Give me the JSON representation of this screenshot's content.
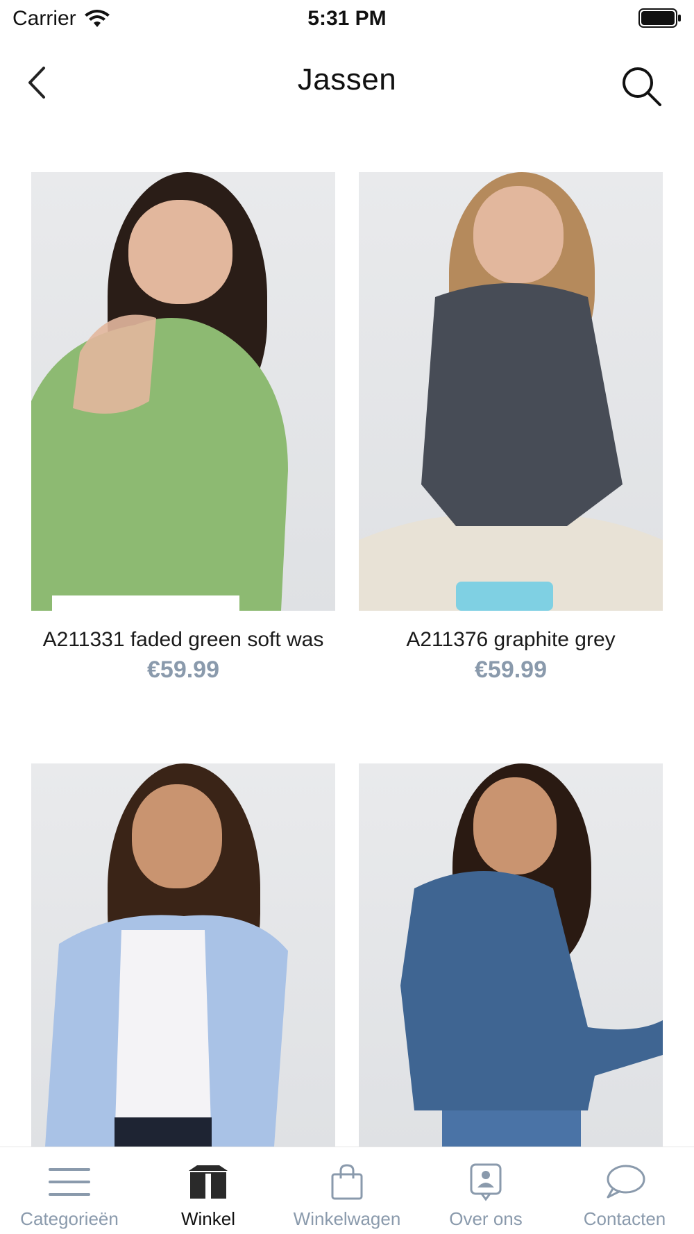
{
  "status_bar": {
    "carrier": "Carrier",
    "time": "5:31 PM"
  },
  "nav": {
    "title": "Jassen"
  },
  "products": [
    {
      "name": "A211331 faded green soft was",
      "price": "€59.99",
      "jacket_color": "#8dba72"
    },
    {
      "name": "A211376 graphite grey",
      "price": "€59.99",
      "jacket_color": "#474c56"
    },
    {
      "name": "",
      "price": "",
      "jacket_color": "#a9c2e6"
    },
    {
      "name": "",
      "price": "",
      "jacket_color": "#3f6592"
    }
  ],
  "tabs": [
    {
      "label": "Categorieën",
      "icon": "menu-icon",
      "active": false
    },
    {
      "label": "Winkel",
      "icon": "store-icon",
      "active": true
    },
    {
      "label": "Winkelwagen",
      "icon": "shopping-bag-icon",
      "active": false
    },
    {
      "label": "Over ons",
      "icon": "contact-card-icon",
      "active": false
    },
    {
      "label": "Contacten",
      "icon": "chat-bubble-icon",
      "active": false
    }
  ],
  "colors": {
    "accent_muted": "#8a9aac",
    "text": "#111111",
    "background": "#ffffff"
  }
}
